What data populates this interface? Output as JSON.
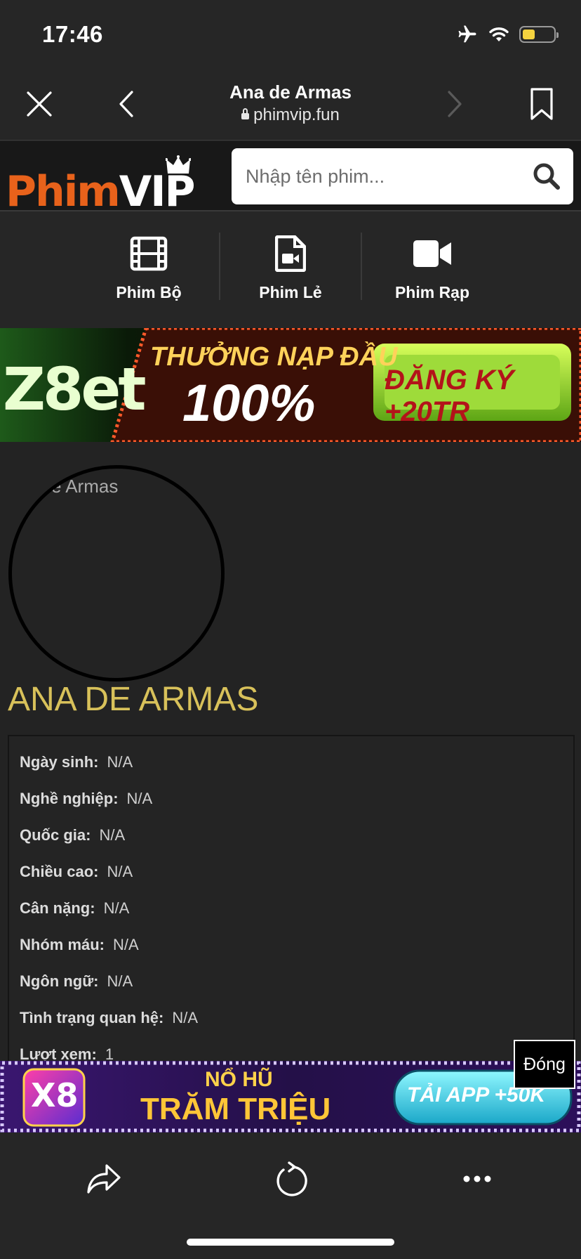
{
  "status_bar": {
    "time": "17:46",
    "battery_level": 0.4,
    "battery_color": "#f5d33f"
  },
  "nav": {
    "title": "Ana de Armas",
    "url": "phimvip.fun"
  },
  "site": {
    "logo_text": "Phim",
    "logo_text_accent": "VIP",
    "search_placeholder": "Nhập tên phim..."
  },
  "categories": [
    {
      "label": "Phim Bộ",
      "icon": "film-icon"
    },
    {
      "label": "Phim Lẻ",
      "icon": "file-video-icon"
    },
    {
      "label": "Phim Rạp",
      "icon": "video-camera-icon"
    }
  ],
  "ad_top": {
    "brand": "Z8et",
    "promo_line1": "THƯỞNG NẠP ĐẦU",
    "promo_line2": "100%",
    "cta": "ĐĂNG KÝ +20TR"
  },
  "profile": {
    "image_alt": "Ana de Armas",
    "name": "ANA DE ARMAS",
    "fields": [
      {
        "label": "Ngày sinh:",
        "value": "N/A"
      },
      {
        "label": "Nghề nghiệp:",
        "value": "N/A"
      },
      {
        "label": "Quốc gia:",
        "value": "N/A"
      },
      {
        "label": "Chiều cao:",
        "value": "N/A"
      },
      {
        "label": "Cân nặng:",
        "value": "N/A"
      },
      {
        "label": "Nhóm máu:",
        "value": "N/A"
      },
      {
        "label": "Ngôn ngữ:",
        "value": "N/A"
      },
      {
        "label": "Tình trạng quan hệ:",
        "value": "N/A"
      },
      {
        "label": "Lượt xem:",
        "value": "1"
      }
    ]
  },
  "ad_bottom": {
    "brand": "X8",
    "line1": "NỔ HŨ",
    "line2": "TRĂM TRIỆU",
    "cta": "TẢI APP +50K",
    "close_label": "Đóng"
  },
  "colors": {
    "accent_name": "#d8c15a",
    "logo_orange": "#e8621b",
    "background": "#232323"
  }
}
